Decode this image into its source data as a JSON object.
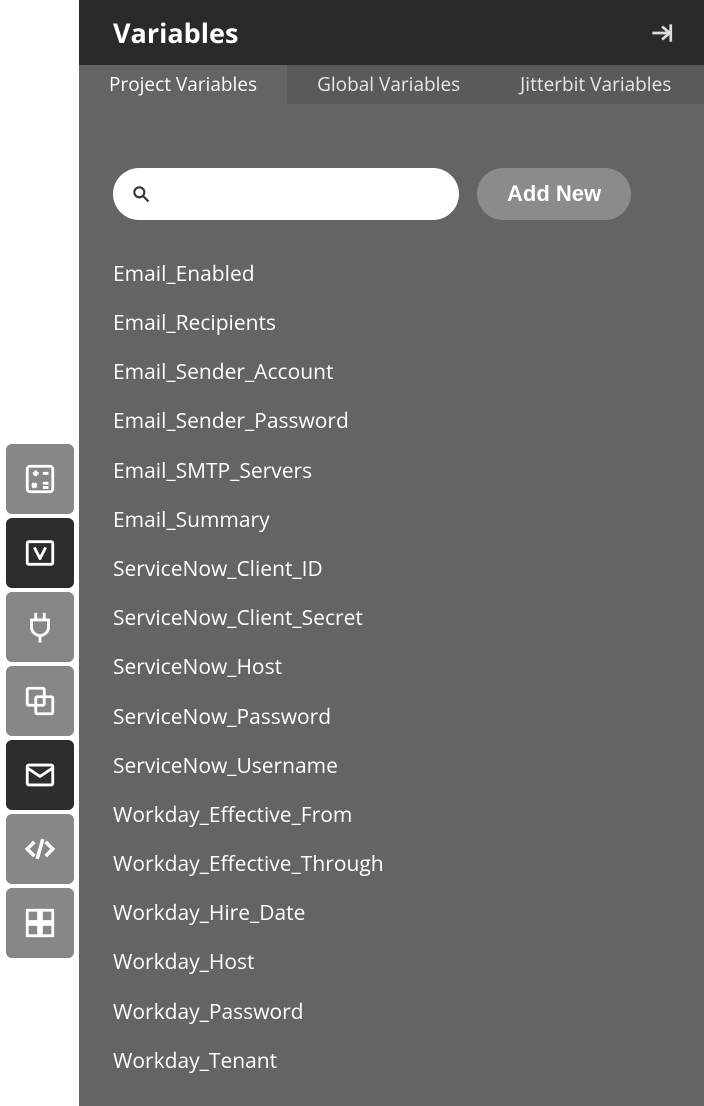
{
  "panel": {
    "title": "Variables",
    "tabs": [
      {
        "label": "Project Variables",
        "active": true
      },
      {
        "label": "Global Variables",
        "active": false
      },
      {
        "label": "Jitterbit Variables",
        "active": false
      }
    ],
    "search": {
      "placeholder": ""
    },
    "addButtonLabel": "Add New",
    "variables": [
      "Email_Enabled",
      "Email_Recipients",
      "Email_Sender_Account",
      "Email_Sender_Password",
      "Email_SMTP_Servers",
      "Email_Summary",
      "ServiceNow_Client_ID",
      "ServiceNow_Client_Secret",
      "ServiceNow_Host",
      "ServiceNow_Password",
      "ServiceNow_Username",
      "Workday_Effective_From",
      "Workday_Effective_Through",
      "Workday_Hire_Date",
      "Workday_Host",
      "Workday_Password",
      "Workday_Tenant"
    ]
  },
  "leftRail": {
    "items": [
      {
        "name": "calculator-icon",
        "style": "dim"
      },
      {
        "name": "variables-icon",
        "style": "dark"
      },
      {
        "name": "plug-icon",
        "style": "dim"
      },
      {
        "name": "link-icon",
        "style": "dim"
      },
      {
        "name": "mail-icon",
        "style": "dark"
      },
      {
        "name": "code-icon",
        "style": "dim"
      },
      {
        "name": "dashboard-icon",
        "style": "dim"
      }
    ]
  }
}
